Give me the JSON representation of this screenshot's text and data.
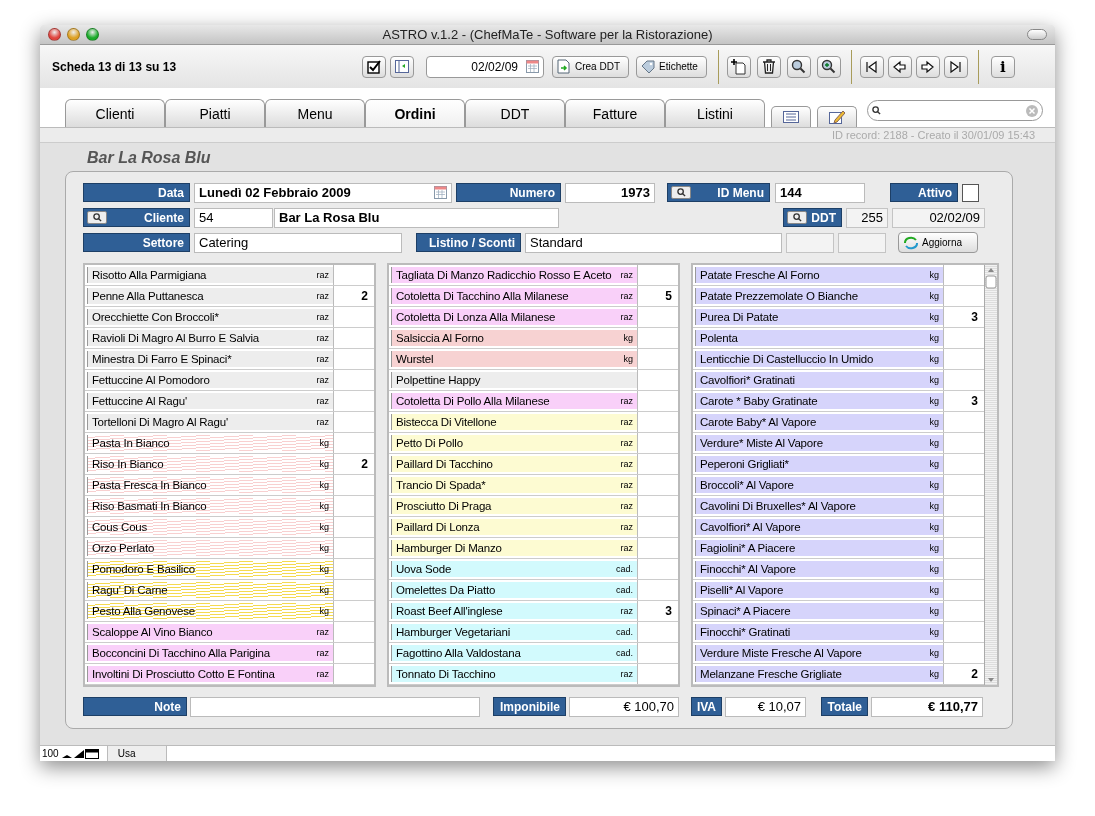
{
  "window": {
    "title": "ASTRO  v.1.2 - (ChefMaTe - Software per la Ristorazione)"
  },
  "toolbar": {
    "record_label": "Scheda 13 di 13 su 13",
    "date": "02/02/09",
    "buttons": [
      "Crea DDT",
      "Etichette"
    ],
    "info": "i"
  },
  "tabs": [
    {
      "label": "Clienti",
      "selected": false
    },
    {
      "label": "Piatti",
      "selected": false
    },
    {
      "label": "Menu",
      "selected": false
    },
    {
      "label": "Ordini",
      "selected": true
    },
    {
      "label": "DDT",
      "selected": false
    },
    {
      "label": "Fatture",
      "selected": false
    },
    {
      "label": "Listini",
      "selected": false
    }
  ],
  "record_info": "ID record: 2188 - Creato il 30/01/09 15:43",
  "form": {
    "title": "Bar La Rosa Blu",
    "data": {
      "label": "Data",
      "value": "Lunedì 02 Febbraio 2009"
    },
    "numero": {
      "label": "Numero",
      "value": "1973"
    },
    "id_menu": {
      "label": "ID Menu",
      "value": "144"
    },
    "attivo": {
      "label": "Attivo",
      "checked": false
    },
    "cliente": {
      "label": "Cliente",
      "code": "54",
      "name": "Bar La Rosa Blu"
    },
    "ddt": {
      "label": "DDT",
      "number": "255",
      "date": "02/02/09"
    },
    "settore": {
      "label": "Settore",
      "value": "Catering"
    },
    "listino": {
      "label": "Listino / Sconti",
      "value": "Standard"
    },
    "update_button": "Aggiorna"
  },
  "columns": [
    [
      {
        "name": "Risotto Alla Parmigiana",
        "unit": "raz",
        "kind": "solid",
        "color": "#ededed"
      },
      {
        "name": "Penne Alla Puttanesca",
        "unit": "raz",
        "qty": "2",
        "kind": "solid",
        "color": "#ededed"
      },
      {
        "name": "Orecchiette Con Broccoli*",
        "unit": "raz",
        "kind": "solid",
        "color": "#ededed"
      },
      {
        "name": "Ravioli Di Magro Al Burro E Salvia",
        "unit": "raz",
        "kind": "solid",
        "color": "#ededed"
      },
      {
        "name": "Minestra Di Farro E Spinaci*",
        "unit": "raz",
        "kind": "solid",
        "color": "#ededed"
      },
      {
        "name": "Fettuccine Al Pomodoro",
        "unit": "raz",
        "kind": "solid",
        "color": "#ededed"
      },
      {
        "name": "Fettuccine Al Ragu'",
        "unit": "raz",
        "kind": "solid",
        "color": "#ededed"
      },
      {
        "name": "Tortelloni Di Magro Al Ragu'",
        "unit": "raz",
        "kind": "solid",
        "color": "#ededed"
      },
      {
        "name": "Pasta In Bianco",
        "unit": "kg",
        "kind": "striped",
        "color": "#f8d0d0"
      },
      {
        "name": "Riso In Bianco",
        "unit": "kg",
        "qty": "2",
        "kind": "striped",
        "color": "#f8d0d0"
      },
      {
        "name": "Pasta Fresca In Bianco",
        "unit": "kg",
        "kind": "striped",
        "color": "#f8d0d0"
      },
      {
        "name": "Riso Basmati In Bianco",
        "unit": "kg",
        "kind": "striped",
        "color": "#f8d0d0"
      },
      {
        "name": "Cous Cous",
        "unit": "kg",
        "kind": "striped",
        "color": "#f8d0d0"
      },
      {
        "name": "Orzo Perlato",
        "unit": "kg",
        "kind": "striped",
        "color": "#f8d0d0"
      },
      {
        "name": "Pomodoro E Basilico",
        "unit": "kg",
        "kind": "striped",
        "color": "#f5da50"
      },
      {
        "name": "Ragu' Di Carne",
        "unit": "kg",
        "kind": "striped",
        "color": "#f5da50"
      },
      {
        "name": "Pesto Alla Genovese",
        "unit": "kg",
        "kind": "striped",
        "color": "#f5da50"
      },
      {
        "name": "Scaloppe Al Vino Bianco",
        "unit": "raz",
        "kind": "solid",
        "color": "#f9d0f9"
      },
      {
        "name": "Bocconcini Di Tacchino Alla Parigina",
        "unit": "raz",
        "kind": "solid",
        "color": "#f9d0f9"
      },
      {
        "name": "Involtini Di Prosciutto Cotto E Fontina",
        "unit": "raz",
        "kind": "solid",
        "color": "#f9d0f9"
      }
    ],
    [
      {
        "name": "Tagliata Di Manzo Radicchio Rosso E Aceto",
        "unit": "raz",
        "kind": "solid",
        "color": "#f9d0f9"
      },
      {
        "name": "Cotoletta Di  Tacchino Alla  Milanese",
        "unit": "raz",
        "qty": "5",
        "kind": "solid",
        "color": "#f9d0f9"
      },
      {
        "name": "Cotoletta Di Lonza Alla Milanese",
        "unit": "raz",
        "kind": "solid",
        "color": "#f9d0f9"
      },
      {
        "name": "Salsiccia Al Forno",
        "unit": "kg",
        "kind": "solid",
        "color": "#f7d2d2"
      },
      {
        "name": "Wurstel",
        "unit": "kg",
        "kind": "solid",
        "color": "#f7d2d2"
      },
      {
        "name": "Polpettine Happy",
        "kind": "solid",
        "color": "#ededed"
      },
      {
        "name": "Cotoletta Di Pollo Alla Milanese",
        "unit": "raz",
        "kind": "solid",
        "color": "#f9d0f9"
      },
      {
        "name": "Bistecca Di Vitellone",
        "unit": "raz",
        "kind": "solid",
        "color": "#fdfbd2"
      },
      {
        "name": "Petto Di Pollo",
        "unit": "raz",
        "kind": "solid",
        "color": "#fdfbd2"
      },
      {
        "name": "Paillard Di Tacchino",
        "unit": "raz",
        "kind": "solid",
        "color": "#fdfbd2"
      },
      {
        "name": "Trancio Di Spada*",
        "unit": "raz",
        "kind": "solid",
        "color": "#fdfbd2"
      },
      {
        "name": "Prosciutto Di Praga",
        "unit": "raz",
        "kind": "solid",
        "color": "#fdfbd2"
      },
      {
        "name": "Paillard Di Lonza",
        "unit": "raz",
        "kind": "solid",
        "color": "#fdfbd2"
      },
      {
        "name": "Hamburger Di Manzo",
        "unit": "raz",
        "kind": "solid",
        "color": "#fdfbd2"
      },
      {
        "name": "Uova Sode",
        "unit": "cad.",
        "kind": "solid",
        "color": "#d2fafd"
      },
      {
        "name": "Omelettes Da Piatto",
        "unit": "cad.",
        "kind": "solid",
        "color": "#d2fafd"
      },
      {
        "name": "Roast Beef All'inglese",
        "unit": "raz",
        "qty": "3",
        "kind": "solid",
        "color": "#d2fafd"
      },
      {
        "name": "Hamburger Vegetariani",
        "unit": "cad.",
        "kind": "solid",
        "color": "#d2fafd"
      },
      {
        "name": "Fagottino Alla Valdostana",
        "unit": "cad.",
        "kind": "solid",
        "color": "#d2fafd"
      },
      {
        "name": "Tonnato Di Tacchino",
        "unit": "raz",
        "kind": "solid",
        "color": "#d2fafd"
      }
    ],
    [
      {
        "name": "Patate Fresche Al Forno",
        "unit": "kg",
        "kind": "solid",
        "color": "#d6d4fb"
      },
      {
        "name": "Patate Prezzemolate O Bianche",
        "unit": "kg",
        "kind": "solid",
        "color": "#d6d4fb"
      },
      {
        "name": "Purea Di Patate",
        "unit": "kg",
        "qty": "3",
        "kind": "solid",
        "color": "#d6d4fb"
      },
      {
        "name": "Polenta",
        "unit": "kg",
        "kind": "solid",
        "color": "#d6d4fb"
      },
      {
        "name": "Lenticchie Di Castelluccio In Umido",
        "unit": "kg",
        "kind": "solid",
        "color": "#d6d4fb"
      },
      {
        "name": "Cavolfiori* Gratinati",
        "unit": "kg",
        "kind": "solid",
        "color": "#d6d4fb"
      },
      {
        "name": "Carote * Baby Gratinate",
        "unit": "kg",
        "qty": "3",
        "kind": "solid",
        "color": "#d6d4fb"
      },
      {
        "name": "Carote Baby* Al Vapore",
        "unit": "kg",
        "kind": "solid",
        "color": "#d6d4fb"
      },
      {
        "name": "Verdure* Miste Al Vapore",
        "unit": "kg",
        "kind": "solid",
        "color": "#d6d4fb"
      },
      {
        "name": "Peperoni Grigliati*",
        "unit": "kg",
        "kind": "solid",
        "color": "#d6d4fb"
      },
      {
        "name": "Broccoli* Al Vapore",
        "unit": "kg",
        "kind": "solid",
        "color": "#d6d4fb"
      },
      {
        "name": "Cavolini Di Bruxelles* Al Vapore",
        "unit": "kg",
        "kind": "solid",
        "color": "#d6d4fb"
      },
      {
        "name": "Cavolfiori* Al Vapore",
        "unit": "kg",
        "kind": "solid",
        "color": "#d6d4fb"
      },
      {
        "name": "Fagiolini* A Piacere",
        "unit": "kg",
        "kind": "solid",
        "color": "#d6d4fb"
      },
      {
        "name": "Finocchi* Al Vapore",
        "unit": "kg",
        "kind": "solid",
        "color": "#d6d4fb"
      },
      {
        "name": "Piselli* Al Vapore",
        "unit": "kg",
        "kind": "solid",
        "color": "#d6d4fb"
      },
      {
        "name": "Spinaci* A Piacere",
        "unit": "kg",
        "kind": "solid",
        "color": "#d6d4fb"
      },
      {
        "name": "Finocchi* Gratinati",
        "unit": "kg",
        "kind": "solid",
        "color": "#d6d4fb"
      },
      {
        "name": "Verdure Miste Fresche Al Vapore",
        "unit": "kg",
        "kind": "solid",
        "color": "#d6d4fb"
      },
      {
        "name": "Melanzane Fresche Grigliate",
        "unit": "kg",
        "qty": "2",
        "kind": "solid",
        "color": "#d6d4fb"
      }
    ]
  ],
  "totals": {
    "note_label": "Note",
    "imponibile_label": "Imponibile",
    "imponibile": "€ 100,70",
    "iva_label": "IVA",
    "iva": "€ 10,07",
    "totale_label": "Totale",
    "totale": "€ 110,77"
  },
  "status_bar": {
    "zoom": "100",
    "mode": "Usa"
  }
}
